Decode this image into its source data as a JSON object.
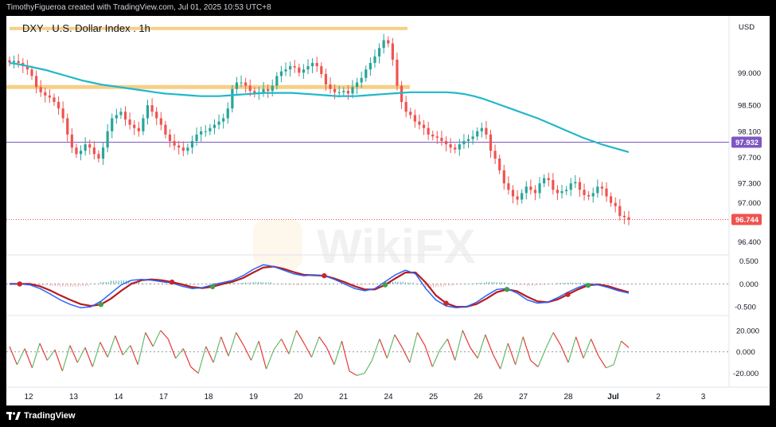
{
  "header": {
    "attribution": "TimothyFigueroa created with TradingView.com, Jul 01, 2025 10:53 UTC+8"
  },
  "footer": {
    "brand": "TradingView"
  },
  "colors": {
    "up": "#26a69a",
    "down": "#ef5350",
    "ma": "#21b8c8",
    "resistance": "#f6cf86",
    "hline": "#7e57c2",
    "macd_fast": "#2962ff",
    "macd_slow": "#b71c1c",
    "macd_fast_up": "#43a047",
    "rsi_up": "#66bb6a",
    "rsi_down": "#e53935"
  },
  "chart_data": [
    {
      "type": "candlestick",
      "title": "DXY . U.S. Dollar Index . 1h",
      "currency": "USD",
      "y_ticks": [
        "99.000",
        "98.500",
        "98.100",
        "97.700",
        "97.300",
        "97.000",
        "96.400"
      ],
      "ylim": [
        96.2,
        99.75
      ],
      "x_labels": [
        "12",
        "13",
        "14",
        "17",
        "18",
        "19",
        "20",
        "21",
        "24",
        "25",
        "26",
        "27",
        "28",
        "Jul",
        "2",
        "3"
      ],
      "price_close_series": [
        99.16,
        99.18,
        99.15,
        99.1,
        99.05,
        98.95,
        98.78,
        98.7,
        98.65,
        98.62,
        98.55,
        98.45,
        98.3,
        98.05,
        97.85,
        97.75,
        97.8,
        97.9,
        97.85,
        97.75,
        97.68,
        97.85,
        98.1,
        98.3,
        98.35,
        98.4,
        98.28,
        98.2,
        98.15,
        98.1,
        98.3,
        98.5,
        98.4,
        98.3,
        98.2,
        98.05,
        97.95,
        97.88,
        97.85,
        97.8,
        97.85,
        97.95,
        98.05,
        98.1,
        98.1,
        98.15,
        98.2,
        98.25,
        98.3,
        98.45,
        98.75,
        98.85,
        98.85,
        98.8,
        98.72,
        98.68,
        98.7,
        98.75,
        98.72,
        98.8,
        98.95,
        99.02,
        99.05,
        99.1,
        99.08,
        99.0,
        99.05,
        99.1,
        99.15,
        99.1,
        98.98,
        98.82,
        98.75,
        98.7,
        98.7,
        98.72,
        98.68,
        98.78,
        98.85,
        98.92,
        99.05,
        99.15,
        99.25,
        99.38,
        99.5,
        99.45,
        99.2,
        98.8,
        98.55,
        98.4,
        98.35,
        98.25,
        98.2,
        98.15,
        98.05,
        98.02,
        98.0,
        97.95,
        97.9,
        97.85,
        97.82,
        97.9,
        97.95,
        97.98,
        98.02,
        98.1,
        98.15,
        98.05,
        97.8,
        97.68,
        97.5,
        97.3,
        97.2,
        97.1,
        97.05,
        97.15,
        97.25,
        97.2,
        97.15,
        97.3,
        97.38,
        97.35,
        97.2,
        97.15,
        97.18,
        97.2,
        97.3,
        97.32,
        97.2,
        97.12,
        97.1,
        97.15,
        97.25,
        97.22,
        97.1,
        97.0,
        96.95,
        96.8,
        96.78,
        96.74
      ],
      "ma_series": [
        99.15,
        99.13,
        99.1,
        99.07,
        99.04,
        99.0,
        98.96,
        98.92,
        98.88,
        98.85,
        98.82,
        98.8,
        98.78,
        98.76,
        98.74,
        98.72,
        98.7,
        98.68,
        98.67,
        98.66,
        98.65,
        98.64,
        98.64,
        98.64,
        98.65,
        98.66,
        98.67,
        98.68,
        98.69,
        98.69,
        98.69,
        98.69,
        98.68,
        98.67,
        98.66,
        98.65,
        98.64,
        98.64,
        98.64,
        98.65,
        98.66,
        98.67,
        98.68,
        98.69,
        98.7,
        98.7,
        98.7,
        98.7,
        98.7,
        98.69,
        98.67,
        98.64,
        98.6,
        98.55,
        98.5,
        98.45,
        98.4,
        98.35,
        98.3,
        98.24,
        98.18,
        98.12,
        98.06,
        98.0,
        97.95,
        97.9,
        97.86,
        97.82,
        97.78
      ],
      "resistance_lines": [
        99.68,
        98.78
      ],
      "horizontal_line": 97.932,
      "horizontal_line_label": "97.932",
      "last_price": 96.744,
      "last_price_label": "96.744"
    },
    {
      "type": "line",
      "name": "MACD",
      "y_ticks": [
        "0.500",
        "0.000",
        "-0.500"
      ],
      "ylim": [
        -0.62,
        0.6
      ],
      "macd": [
        0.0,
        0.0,
        -0.02,
        -0.1,
        -0.22,
        -0.35,
        -0.45,
        -0.52,
        -0.5,
        -0.38,
        -0.2,
        -0.02,
        0.08,
        0.1,
        0.08,
        0.05,
        0.02,
        -0.05,
        -0.1,
        -0.08,
        -0.02,
        0.03,
        0.08,
        0.18,
        0.32,
        0.42,
        0.38,
        0.3,
        0.22,
        0.18,
        0.2,
        0.18,
        0.1,
        0.0,
        -0.1,
        -0.15,
        -0.1,
        0.05,
        0.2,
        0.3,
        0.22,
        -0.1,
        -0.35,
        -0.48,
        -0.52,
        -0.5,
        -0.4,
        -0.25,
        -0.12,
        -0.1,
        -0.2,
        -0.35,
        -0.42,
        -0.4,
        -0.3,
        -0.18,
        -0.08,
        0.0,
        -0.02,
        -0.08,
        -0.15,
        -0.2
      ],
      "signal": [
        0.0,
        0.0,
        0.0,
        -0.05,
        -0.14,
        -0.25,
        -0.35,
        -0.44,
        -0.48,
        -0.45,
        -0.32,
        -0.15,
        0.0,
        0.08,
        0.1,
        0.08,
        0.04,
        -0.01,
        -0.07,
        -0.09,
        -0.06,
        0.0,
        0.05,
        0.13,
        0.25,
        0.36,
        0.38,
        0.33,
        0.26,
        0.2,
        0.19,
        0.18,
        0.12,
        0.04,
        -0.05,
        -0.12,
        -0.12,
        -0.02,
        0.12,
        0.25,
        0.25,
        0.03,
        -0.25,
        -0.42,
        -0.5,
        -0.5,
        -0.44,
        -0.32,
        -0.18,
        -0.12,
        -0.16,
        -0.28,
        -0.38,
        -0.4,
        -0.34,
        -0.23,
        -0.12,
        -0.03,
        -0.01,
        -0.05,
        -0.12,
        -0.18
      ],
      "cross_points": [
        1,
        9,
        16,
        20,
        31,
        37,
        43,
        49,
        55,
        57
      ]
    },
    {
      "type": "line",
      "name": "Oscillator",
      "y_ticks": [
        "20.000",
        "0.000",
        "-20.000"
      ],
      "ylim": [
        -30,
        28
      ],
      "values": [
        5,
        -12,
        3,
        -15,
        8,
        -8,
        2,
        -18,
        6,
        -10,
        4,
        -14,
        9,
        -5,
        15,
        -3,
        6,
        -12,
        18,
        5,
        20,
        12,
        -6,
        3,
        -14,
        -20,
        5,
        -10,
        14,
        -4,
        18,
        6,
        -8,
        10,
        -16,
        2,
        12,
        -2,
        20,
        8,
        -5,
        14,
        4,
        -12,
        10,
        -18,
        -22,
        -20,
        -8,
        12,
        -6,
        16,
        4,
        -10,
        18,
        6,
        -14,
        2,
        12,
        -8,
        20,
        4,
        -6,
        16,
        -2,
        -16,
        8,
        -12,
        14,
        -8,
        -14,
        3,
        18,
        6,
        -10,
        14,
        -6,
        12,
        -4,
        -15,
        -12,
        10,
        4
      ]
    }
  ]
}
